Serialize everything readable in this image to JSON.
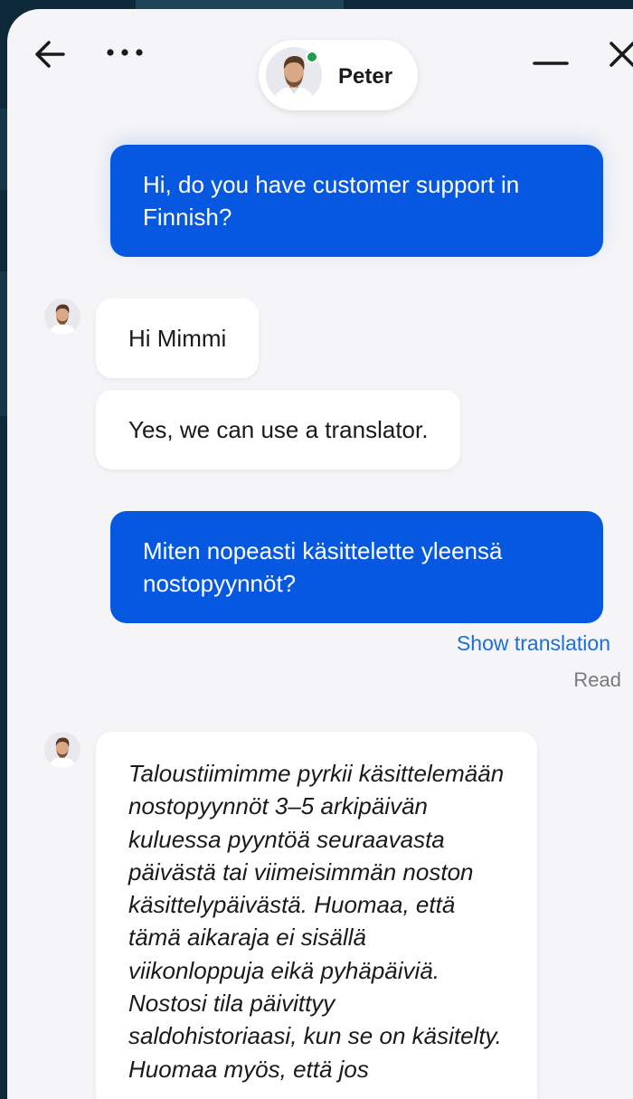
{
  "header": {
    "back_icon": "arrow-left-icon",
    "more_icon": "more-horizontal-icon",
    "minimize_icon": "minimize-icon",
    "close_icon": "close-icon",
    "agent": {
      "name": "Peter",
      "status": "online"
    }
  },
  "messages": {
    "m1": "Hi, do you have customer support in Finnish?",
    "m2": "Hi Mimmi",
    "m3": "Yes, we can use a translator.",
    "m4": "Miten nopeasti käsittelette yleensä nostopyynnöt?",
    "m4_show_translation": "Show translation",
    "m4_status": "Read",
    "m5": "Taloustiimimme pyrkii käsittelemään nostopyynnöt 3–5 arkipäivän kuluessa pyyntöä seuraavasta päivästä tai viimeisimmän noston käsittelypäivästä. Huomaa, että tämä aikaraja ei sisällä viikonloppuja eikä pyhäpäiviä. Nostosi tila päivittyy saldohistoriaasi, kun se on käsitelty. Huomaa myös, että jos"
  },
  "colors": {
    "user_bubble": "#0658e1",
    "agent_bubble": "#ffffff",
    "panel_bg": "#f5f5f7",
    "link": "#1b6fd6",
    "online": "#1e9e4a"
  }
}
